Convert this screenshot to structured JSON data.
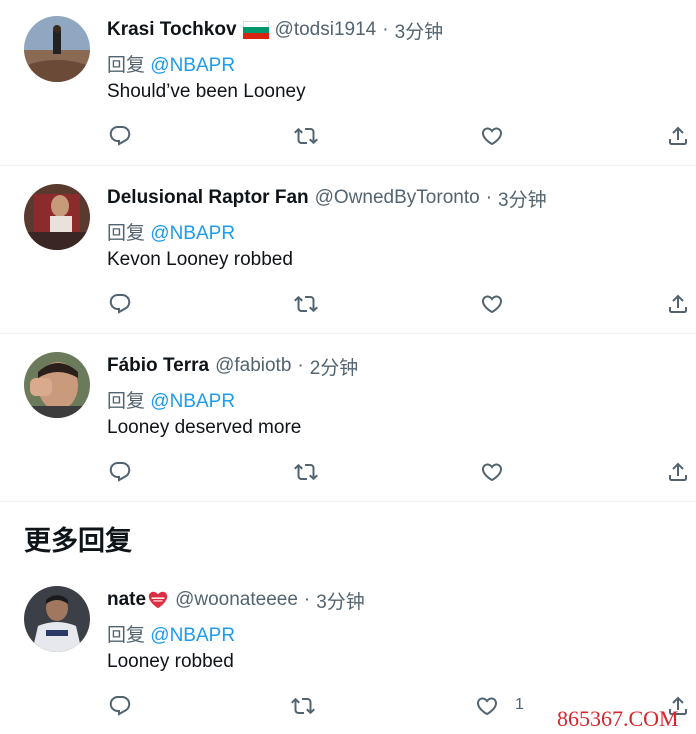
{
  "section_title": "更多回复",
  "reply_prefix": "回复",
  "tweets": [
    {
      "name": "Krasi Tochkov",
      "flag": "bulgaria",
      "handle": "@todsi1914",
      "separator": "·",
      "time": "3分钟",
      "reply_to": "@NBAPR",
      "text": "Should’ve been Looney"
    },
    {
      "name": "Delusional Raptor Fan",
      "handle": "@OwnedByToronto",
      "separator": "·",
      "time": "3分钟",
      "reply_to": "@NBAPR",
      "text": "Kevon Looney robbed"
    },
    {
      "name": "Fábio Terra",
      "handle": "@fabiotb",
      "separator": "·",
      "time": "2分钟",
      "reply_to": "@NBAPR",
      "text": "Looney deserved more"
    },
    {
      "name": "nate",
      "name_emoji": "heart-emoji",
      "handle": "@woonateeee",
      "separator": "·",
      "time": "3分钟",
      "reply_to": "@NBAPR",
      "text": "Looney robbed",
      "like_count": "1"
    }
  ],
  "watermark": "865367.COM",
  "icons": [
    "reply-icon",
    "retweet-icon",
    "like-icon",
    "share-icon"
  ],
  "colors": {
    "link": "#1d9bf0",
    "muted": "#536471",
    "text": "#0f1419",
    "watermark": "#d9262c"
  }
}
